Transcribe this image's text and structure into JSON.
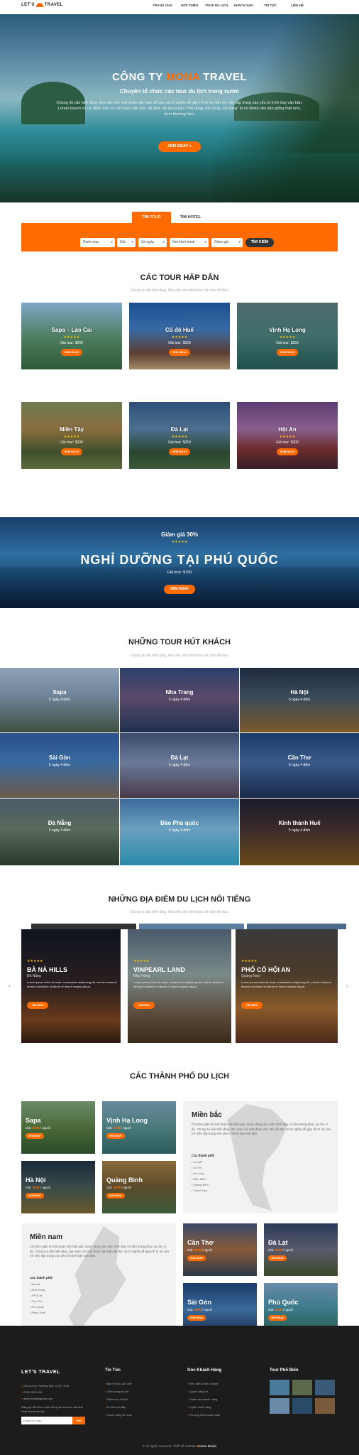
{
  "header": {
    "logo": "LET'S TRAVEL",
    "nav": [
      "TRANG CHỦ",
      "GIỚI THIỆU",
      "TOUR DU LỊCH",
      "KHÁCH SẠN",
      "TIN TỨC",
      "LIÊN HỆ"
    ]
  },
  "hero": {
    "title_pre": "CÔNG TY",
    "title_hl": "MONA",
    "title_post": "TRAVEL",
    "subtitle": "Chuyên tổ chức các tour du lịch trong nước",
    "desc": "Chúng tôi cần biết rằng, làm việc với một đoạn văn bản dễ đọc và rõ nghĩa dễ gây rối trí và cản trở việc tập trung vào yếu tố trình bày văn bản. Lorem Ipsum có ưu điểm hơn so với đoạn văn bản chỉ gồm nội dung kiểu \"Nội dung, nội dung, nội dung\" là nó khiến văn bản giống thật hơn, bình thường hơn.",
    "button": "XEM NGAY"
  },
  "search": {
    "tabs": [
      "TÌM TOUR",
      "TÌM HOTEL"
    ],
    "fields": [
      "Danh mục",
      "Giá",
      "Số ngày",
      "Nơi khởi hành",
      "Giảm giá"
    ],
    "button": "TÌM KIẾM"
  },
  "featured": {
    "title": "CÁC TOUR HẤP DẪN",
    "subtitle": "Chúng ta vẫn biết rằng, làm việc với một đoạn văn bản dễ đọc.",
    "items": [
      {
        "name": "Sapa – Lào Cai",
        "stars": "★★★★★",
        "price": "Giá tour: $200",
        "btn": "XEM NGAY"
      },
      {
        "name": "Cố đô Huế",
        "stars": "★★★★★",
        "price": "Giá tour: $200",
        "btn": "XEM NGAY"
      },
      {
        "name": "Vịnh Hạ Long",
        "stars": "★★★★★",
        "price": "Giá tour: $250",
        "btn": "XEM NGAY"
      },
      {
        "name": "Miền Tây",
        "stars": "★★★★★",
        "price": "Giá tour: $200",
        "btn": "XEM NGAY"
      },
      {
        "name": "Đà Lạt",
        "stars": "★★★★★",
        "price": "Giá tour: $250",
        "btn": "XEM NGAY"
      },
      {
        "name": "Hội An",
        "stars": "★★★★★",
        "price": "Giá tour: $300",
        "btn": "XEM NGAY"
      }
    ]
  },
  "promo": {
    "discount": "Giảm giá 30%",
    "stars": "★★★★★",
    "title": "NGHỈ DƯỠNG TẠI PHÚ QUỐC",
    "price": "Giá tour: $150",
    "button": "XEM NGAY"
  },
  "hot": {
    "title": "NHỮNG TOUR HÚT KHÁCH",
    "subtitle": "Chúng ta vẫn biết rằng, làm việc với một đoạn văn bản dễ đọc.",
    "items": [
      {
        "name": "Sapa",
        "days": "5 ngày 4 đêm"
      },
      {
        "name": "Nha Trang",
        "days": "5 ngày 4 đêm"
      },
      {
        "name": "Hà Nội",
        "days": "5 ngày 4 đêm"
      },
      {
        "name": "Sài Gòn",
        "days": "5 ngày 4 đêm"
      },
      {
        "name": "Đà Lạt",
        "days": "5 ngày 4 đêm"
      },
      {
        "name": "Cần Thơ",
        "days": "5 ngày 4 đêm"
      },
      {
        "name": "Đà Nẵng",
        "days": "5 ngày 4 đêm"
      },
      {
        "name": "Đảo Phú quốc",
        "days": "5 ngày 4 đêm"
      },
      {
        "name": "Kinh thành Huế",
        "days": "5 ngày 4 đêm"
      }
    ]
  },
  "famous": {
    "title": "NHỮNG ĐỊA ĐIỂM DU LỊCH NỔI TIẾNG",
    "subtitle": "Chúng ta vẫn biết rằng, làm việc với một đoạn văn bản dễ đọc.",
    "items": [
      {
        "stars": "★★★★★",
        "name": "BÀ NÀ HILLS",
        "loc": "Đà Nẵng",
        "desc": "Lorem ipsum dolor sit amet, consectetur adipiscing elit, sed do eiusmod tempor incididunt ut labore et dolore magna aliqua.",
        "btn": "TÌM HIỂU"
      },
      {
        "stars": "★★★★★",
        "name": "VINPEARL LAND",
        "loc": "Nha Trang",
        "desc": "Lorem ipsum dolor sit amet, consectetur adipiscing elit, sed do eiusmod tempor incididunt ut labore et dolore magna aliqua.",
        "btn": "TÌM HIỂU"
      },
      {
        "stars": "★★★★★",
        "name": "PHỐ CỔ HỘI AN",
        "loc": "Quảng Nam",
        "desc": "Lorem ipsum dolor sit amet, consectetur adipiscing elit, sed do eiusmod tempor incididunt ut labore et dolore magna aliqua.",
        "btn": "TÌM HIỂU"
      }
    ]
  },
  "cities": {
    "title": "CÁC THÀNH PHỐ DU LỊCH",
    "items": [
      {
        "name": "Sapa",
        "price_label": "Giá:",
        "price": "300$",
        "unit": "/ người",
        "btn": "XEM NGAY"
      },
      {
        "name": "Vịnh Hạ Long",
        "price_label": "Giá:",
        "price": "300$",
        "unit": "/ người",
        "btn": "XEM NGAY"
      },
      {
        "name": "Hà Nội",
        "price_label": "Giá:",
        "price": "300$",
        "unit": "/ người",
        "btn": "XEM NGAY"
      },
      {
        "name": "Quảng Bình",
        "price_label": "Giá:",
        "price": "300$",
        "unit": "/ người",
        "btn": "XEM NGAY"
      },
      {
        "name": "Cần Thơ",
        "price_label": "Giá:",
        "price": "300$",
        "unit": "/ người",
        "btn": "XEM NGAY"
      },
      {
        "name": "Đà Lạt",
        "price_label": "Giá:",
        "price": "300$",
        "unit": "/ người",
        "btn": "XEM NGAY"
      },
      {
        "name": "Sài Gòn",
        "price_label": "Giá:",
        "price": "300$",
        "unit": "/ người",
        "btn": "XEM NGAY"
      },
      {
        "name": "Phú Quốc",
        "price_label": "Giá:",
        "price": "300$",
        "unit": "/ người",
        "btn": "XEM NGAY"
      }
    ],
    "north": {
      "title": "Miền bắc",
      "desc": "Chỉ đơn giản là một đoạn văn bản giả, được dùng vào việc trình bày và dàn trang phục vụ cho in ấn. Chúng ta vẫn biết rằng, làm việc với một đoạn văn bản dễ đọc và rõ nghĩa dễ gây rối trí và cản trở việc tập trung vào yếu tố trình bày văn bản.",
      "head": "Các thành phố:",
      "list": [
        "Hà Nội",
        "Sa Pa",
        "Hạ Long",
        "Điện Biên",
        "Quảng Bình",
        "Thanh Hóa"
      ]
    },
    "south": {
      "title": "Miền nam",
      "desc": "Chỉ đơn giản là một đoạn văn bản giả, được dùng vào việc trình bày và dàn trang phục vụ cho in ấn. Chúng ta vẫn biết rằng, làm việc với một đoạn văn bản dễ đọc và rõ nghĩa dễ gây rối trí và cản trở việc tập trung vào yếu tố trình bày văn bản.",
      "head": "Các thành phố:",
      "list": [
        "Đà Lạt",
        "Nha Trang",
        "TP.HCM",
        "Cần Thơ",
        "Phú Quốc",
        "Phan Thiết"
      ]
    }
  },
  "footer": {
    "logo": "LET'S TRAVEL",
    "address": "319 c16 Lý Thường Kiệt, Q.11, HCM",
    "phone": "0728 553 0193",
    "email": "demoemail@gmail.com",
    "news_text": "Đăng ký để được nhận thông tin khuyến mãi mới nhất nhanh chóng.",
    "email_placeholder": "Email của bạn",
    "send": "Gửi",
    "col1": {
      "title": "Tin Tức",
      "items": [
        "Bản tin Du Lịch Việt",
        "Cẩm nang du lịch",
        "Phiêm du du lịch",
        "Du hiện tại đây",
        "Tuyến dụng Du Lịch"
      ]
    },
    "col2": {
      "title": "Góc Khách Hàng",
      "items": [
        "Điều kiện & điều khoản",
        "Quyền riêng tư",
        "Chăm sóc khách hàng",
        "Tuyển nhân hàng",
        "Phương thức thanh toán"
      ]
    },
    "col3": {
      "title": "Tour Phổ Biến"
    },
    "copyright": "© All rights reserved. Thiết kế website",
    "brand": "Mona Media"
  },
  "colors": {
    "accent": "#ff6b00",
    "dark": "#1c1c1c"
  }
}
